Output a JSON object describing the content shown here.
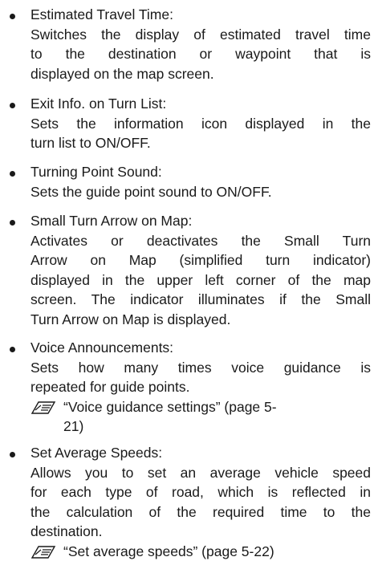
{
  "items": [
    {
      "title": "Estimated Travel Time:",
      "desc": [
        "Switches the display of estimated travel time",
        "to the destination or waypoint that is",
        "displayed on the map screen."
      ]
    },
    {
      "title": "Exit Info. on Turn List:",
      "desc": [
        "Sets the information icon displayed in the",
        "turn list to ON/OFF."
      ]
    },
    {
      "title": "Turning Point Sound:",
      "desc": [
        "Sets the guide point sound to ON/OFF."
      ]
    },
    {
      "title": "Small Turn Arrow on Map:",
      "desc": [
        "Activates or deactivates the Small Turn",
        "Arrow on Map (simplified turn indicator)",
        "displayed in the upper left corner of the map",
        "screen. The indicator illuminates if the Small",
        "Turn Arrow on Map is displayed."
      ]
    },
    {
      "title": "Voice Announcements:",
      "desc": [
        "Sets how many times voice guidance is",
        "repeated for guide points."
      ],
      "ref_line1": "“Voice guidance settings” (page 5-",
      "ref_line2": "21)"
    },
    {
      "title": "Set Average Speeds:",
      "desc": [
        "Allows you to set an average vehicle speed",
        "for each type of road, which is reflected in",
        "the calculation of the required time to the",
        "destination."
      ],
      "ref_line1": "“Set average speeds” (page 5-22)"
    }
  ],
  "ref_icon": "manual-reference-icon"
}
